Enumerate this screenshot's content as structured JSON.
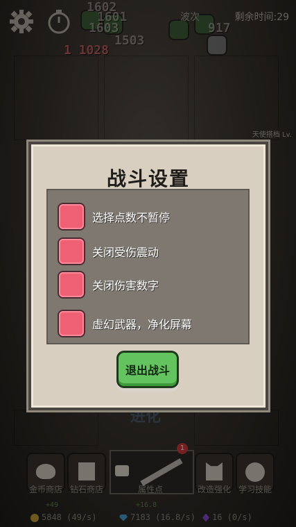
{
  "hud": {
    "time_remaining": "剩余时间:29",
    "wave": "波次",
    "angel": "天使搭档 Lv."
  },
  "damage_numbers": [
    "1602",
    "1601",
    "1603",
    "1503",
    "1 1028",
    "917"
  ],
  "dialog": {
    "title": "战斗设置",
    "options": [
      {
        "label": "选择点数不暂停",
        "checked": false
      },
      {
        "label": "关闭受伤震动",
        "checked": false
      },
      {
        "label": "关闭伤害数字",
        "checked": false
      },
      {
        "label": "虚幻武器，净化屏幕",
        "checked": false
      }
    ],
    "exit_label": "退出战斗"
  },
  "background_text": {
    "evolve": "进化"
  },
  "bottom_nav": {
    "items": [
      {
        "label": "金币商店",
        "icon": "coin-bag-icon"
      },
      {
        "label": "钻石商店",
        "icon": "gem-box-icon"
      },
      {
        "label": "属性点",
        "icon": "sword-icon",
        "badge": "1"
      },
      {
        "label": "改造强化",
        "icon": "demon-mask-icon"
      },
      {
        "label": "学习技能",
        "icon": "flower-icon"
      }
    ]
  },
  "resources": {
    "gold": "5848 (49/s)",
    "gems": "7183 (16.8/s)",
    "crystals": "16 (0/s)",
    "gold_gain": "+49",
    "gem_gain": "+16.8"
  },
  "colors": {
    "checkbox": "#f06074",
    "exit_button": "#63c35e",
    "dialog_bg": "#d8cfc0",
    "panel_bg": "#7e7870"
  }
}
